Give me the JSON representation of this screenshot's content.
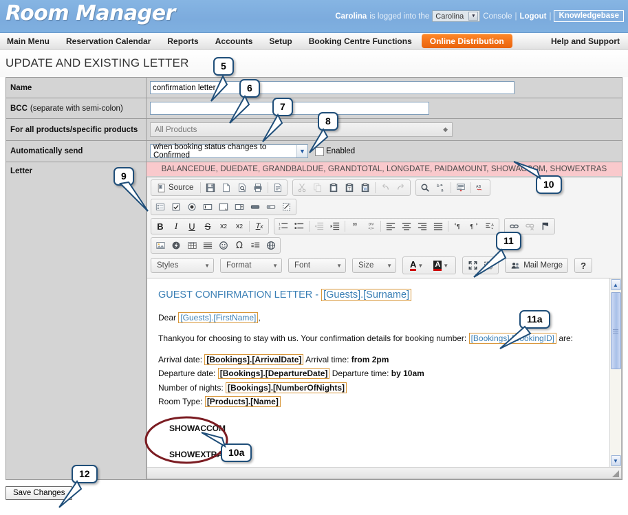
{
  "header": {
    "brand": "Room Manager",
    "user": "Carolina",
    "logged_text": "is logged into the",
    "console_value": "Carolina",
    "console_word": "Console",
    "logout": "Logout",
    "knowledgebase": "Knowledgebase",
    "separator": "|",
    "bg_color": "#7fb0e0"
  },
  "nav": {
    "items": [
      {
        "label": "Main Menu",
        "active": false
      },
      {
        "label": "Reservation Calendar",
        "active": false
      },
      {
        "label": "Reports",
        "active": false
      },
      {
        "label": "Accounts",
        "active": false
      },
      {
        "label": "Setup",
        "active": false
      },
      {
        "label": "Booking Centre Functions",
        "active": false
      },
      {
        "label": "Online Distribution",
        "active": true
      }
    ],
    "help": "Help and Support",
    "active_color": "#f4741a"
  },
  "page": {
    "title": "UPDATE AND EXISTING LETTER"
  },
  "form": {
    "name_label": "Name",
    "name_value": "confirmation letter",
    "bcc_label_bold": "BCC",
    "bcc_label_rest": "(separate with semi-colon)",
    "bcc_value": "",
    "products_label": "For all products/specific products",
    "products_value": "All Products",
    "autosend_label": "Automatically send",
    "autosend_value": "when booking status changes to Confirmed",
    "enabled_label": "Enabled",
    "enabled_checked": false,
    "letter_label": "Letter"
  },
  "merge_banner": {
    "text": "BALANCEDUE, DUEDATE, GRANDBALDUE, GRANDTOTAL, LONGDATE, PAIDAMOUNT, SHOWACCOM, SHOWEXTRAS",
    "bg_color": "#f9c9cc"
  },
  "editor": {
    "toolbar_row1": [
      {
        "name": "source-button",
        "label": "Source",
        "icon": "source-icon"
      },
      {
        "name": "save-icon",
        "label": "",
        "icon": "save-icon"
      },
      {
        "name": "new-page-icon",
        "label": "",
        "icon": "new-page-icon"
      },
      {
        "name": "preview-icon",
        "label": "",
        "icon": "preview-icon"
      },
      {
        "name": "print-icon",
        "label": "",
        "icon": "print-icon"
      },
      {
        "name": "templates-icon",
        "label": "",
        "icon": "templates-icon"
      },
      {
        "name": "cut-icon",
        "label": "",
        "icon": "cut-icon"
      },
      {
        "name": "copy-icon",
        "label": "",
        "icon": "copy-icon"
      },
      {
        "name": "paste-icon",
        "label": "",
        "icon": "paste-icon"
      },
      {
        "name": "paste-text-icon",
        "label": "",
        "icon": "paste-text-icon"
      },
      {
        "name": "paste-word-icon",
        "label": "",
        "icon": "paste-word-icon"
      },
      {
        "name": "undo-icon",
        "label": "",
        "icon": "undo-icon"
      },
      {
        "name": "redo-icon",
        "label": "",
        "icon": "redo-icon"
      },
      {
        "name": "find-icon",
        "label": "",
        "icon": "find-icon"
      },
      {
        "name": "replace-icon",
        "label": "",
        "icon": "replace-icon"
      },
      {
        "name": "select-all-icon",
        "label": "",
        "icon": "select-all-icon"
      },
      {
        "name": "spellcheck-icon",
        "label": "",
        "icon": "spellcheck-icon"
      }
    ],
    "toolbar_row2": [
      "form-icon",
      "checkbox-icon",
      "radio-icon",
      "text-field-icon",
      "textarea-icon",
      "select-field-icon",
      "button-icon",
      "image-button-icon",
      "hidden-field-icon"
    ],
    "toolbar_row3": [
      "bold-icon",
      "italic-icon",
      "underline-icon",
      "strike-icon",
      "subscript-icon",
      "superscript-icon",
      "remove-format-icon",
      "numbered-list-icon",
      "bulleted-list-icon",
      "outdent-icon",
      "indent-icon",
      "blockquote-icon",
      "div-container-icon",
      "align-left-icon",
      "align-center-icon",
      "align-right-icon",
      "justify-icon",
      "ltr-icon",
      "rtl-icon",
      "language-icon",
      "link-icon",
      "unlink-icon",
      "anchor-icon"
    ],
    "toolbar_row4": [
      "image-icon",
      "flash-icon",
      "table-icon",
      "horizontal-rule-icon",
      "smiley-icon",
      "special-char-icon",
      "page-break-icon",
      "iframe-icon"
    ],
    "combos": [
      {
        "name": "styles-combo",
        "label": "Styles"
      },
      {
        "name": "format-combo",
        "label": "Format"
      },
      {
        "name": "font-combo",
        "label": "Font"
      },
      {
        "name": "size-combo",
        "label": "Size"
      }
    ],
    "text_color_label": "A",
    "bg_color_label": "A",
    "mail_merge_label": "Mail Merge",
    "help_label": "?"
  },
  "letter": {
    "title_text": "GUEST CONFIRMATION LETTER - ",
    "title_field": "[Guests].[Surname]",
    "greeting_prefix": "Dear ",
    "greeting_field": "[Guests].[FirstName]",
    "greeting_suffix": ",",
    "intro_prefix": "Thankyou for choosing to stay with us. Your confirmation details for booking number: ",
    "intro_field": "[Bookings].[BookingID]",
    "intro_suffix": " are:",
    "arrival_label": "Arrival date: ",
    "arrival_field": "[Bookings].[ArrivalDate]",
    "arrival_time_label": " Arrival time: ",
    "arrival_time_value": "from 2pm",
    "departure_label": "Departure date: ",
    "departure_field": "[Bookings].[DepartureDate]",
    "departure_time_label": " Departure time: ",
    "departure_time_value": "by 10am",
    "nights_label": "Number of nights: ",
    "nights_field": "[Bookings].[NumberOfNights]",
    "roomtype_label": "Room Type: ",
    "roomtype_field": "[Products].[Name]",
    "show_accom": "SHOWACCOM",
    "show_extras": "SHOWEXTRAS",
    "merge_field_border_color": "#d8973a",
    "heading_color": "#3a7fb5"
  },
  "footer": {
    "save_label": "Save Changes"
  },
  "callouts": [
    {
      "id": "5",
      "label": "5"
    },
    {
      "id": "6",
      "label": "6"
    },
    {
      "id": "7",
      "label": "7"
    },
    {
      "id": "8",
      "label": "8"
    },
    {
      "id": "9",
      "label": "9"
    },
    {
      "id": "10",
      "label": "10"
    },
    {
      "id": "10a",
      "label": "10a"
    },
    {
      "id": "11",
      "label": "11"
    },
    {
      "id": "11a",
      "label": "11a"
    },
    {
      "id": "12",
      "label": "12"
    }
  ],
  "annotation": {
    "ellipse_color": "#7b1c22",
    "callout_border_color": "#1f4e79"
  }
}
